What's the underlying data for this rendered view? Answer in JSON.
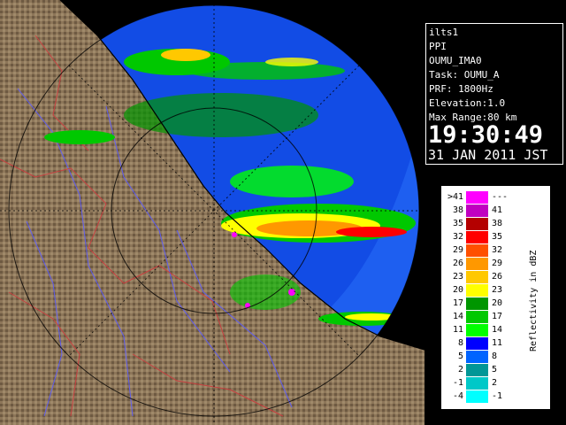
{
  "info": {
    "lines": [
      "ilts1",
      "PPI",
      "OUMU_IMA0",
      "Task: OUMU_A",
      "PRF: 1800Hz",
      "Elevation:1.0",
      "Max Range:80 km"
    ],
    "time": "19:30:49",
    "date": "31 JAN 2011 JST"
  },
  "legend": {
    "title": "Reflectivity in dBZ",
    "rows": [
      {
        "left": ">41",
        "right": "---",
        "color": "#ff00ff"
      },
      {
        "left": "38",
        "right": "41",
        "color": "#c000c0"
      },
      {
        "left": "35",
        "right": "38",
        "color": "#b40000"
      },
      {
        "left": "32",
        "right": "35",
        "color": "#ff0000"
      },
      {
        "left": "29",
        "right": "32",
        "color": "#ff5000"
      },
      {
        "left": "26",
        "right": "29",
        "color": "#ff9800"
      },
      {
        "left": "23",
        "right": "26",
        "color": "#ffc800"
      },
      {
        "left": "20",
        "right": "23",
        "color": "#ffff00"
      },
      {
        "left": "17",
        "right": "20",
        "color": "#009600"
      },
      {
        "left": "14",
        "right": "17",
        "color": "#00c800"
      },
      {
        "left": "11",
        "right": "14",
        "color": "#00ff00"
      },
      {
        "left": "8",
        "right": "11",
        "color": "#0000ff"
      },
      {
        "left": "5",
        "right": "8",
        "color": "#0064ff"
      },
      {
        "left": "2",
        "right": "5",
        "color": "#009696"
      },
      {
        "left": "-1",
        "right": "2",
        "color": "#00c8c8"
      },
      {
        "left": "-4",
        "right": "-1",
        "color": "#00ffff"
      }
    ]
  },
  "colors": {
    "sea_outer": "#1e5ff0",
    "sea_inner": "#0a3cdc",
    "land": "#8a7458",
    "range_ring": "#000000",
    "rivers": "#5a5aff",
    "borders": "#c84040"
  }
}
